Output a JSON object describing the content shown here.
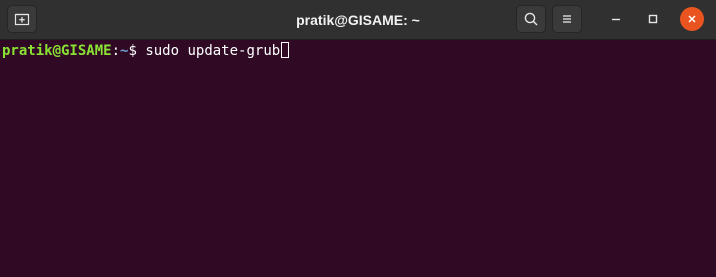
{
  "window": {
    "title": "pratik@GISAME: ~"
  },
  "titlebar": {
    "new_tab_icon": "new-tab-icon",
    "search_icon": "search-icon",
    "menu_icon": "hamburger-menu-icon",
    "minimize_icon": "minimize-icon",
    "maximize_icon": "maximize-icon",
    "close_icon": "close-icon",
    "close_color": "#e95420"
  },
  "terminal": {
    "background": "#300a24",
    "prompt": {
      "user_host": "pratik@GISAME",
      "separator": ":",
      "path": "~",
      "symbol": "$ "
    },
    "command": "sudo update-grub",
    "colors": {
      "user_host": "#8ae234",
      "path": "#729fcf",
      "text": "#ffffff"
    }
  }
}
